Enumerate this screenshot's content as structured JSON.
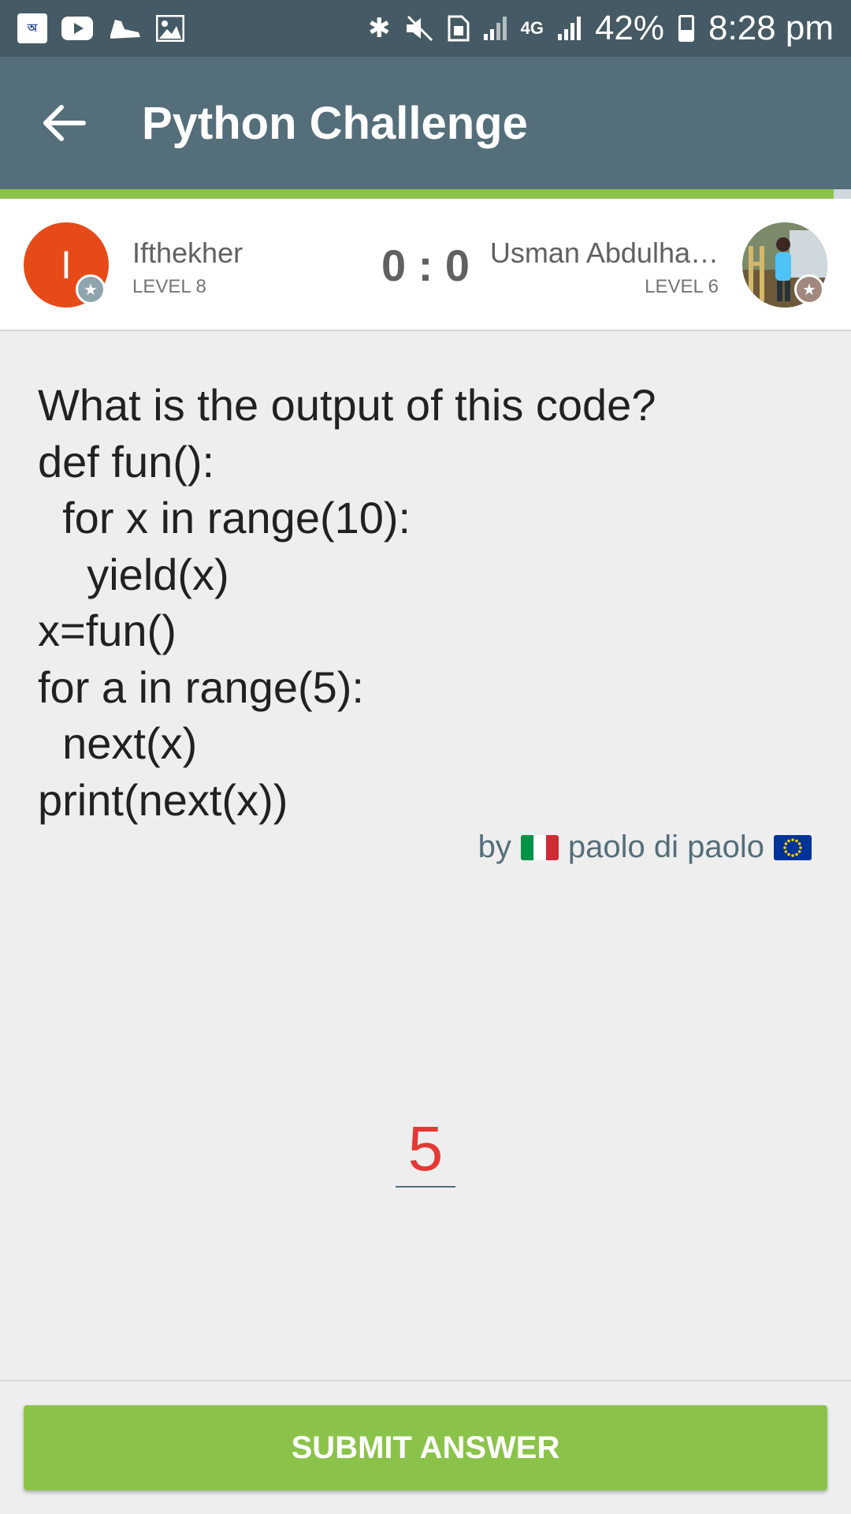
{
  "status_bar": {
    "battery": "42%",
    "time": "8:28 pm",
    "network": "4G",
    "icons_left": [
      "bangla-app-icon",
      "youtube-icon",
      "shoe-icon",
      "gallery-icon"
    ],
    "icons_right": [
      "bluetooth-icon",
      "mute-icon",
      "sim-icon",
      "signal-icon",
      "4g-icon",
      "signal-icon",
      "battery-icon"
    ]
  },
  "toolbar": {
    "title": "Python Challenge",
    "back_icon": "arrow-back-icon"
  },
  "progress": {
    "fraction": 0.98,
    "color": "#8bc34a"
  },
  "player_left": {
    "initial": "I",
    "name": "Ifthekher",
    "level": "LEVEL 8",
    "avatar_color": "#e64a19"
  },
  "player_right": {
    "name": "Usman Abdulha…",
    "level": "LEVEL 6"
  },
  "score": "0 : 0",
  "question": {
    "lines": [
      "What is the output of this code?",
      "def fun():",
      "  for x in range(10):",
      "    yield(x)",
      "x=fun()",
      "for a in range(5):",
      "  next(x)",
      "print(next(x))"
    ]
  },
  "author": {
    "prefix": "by",
    "name": "paolo di paolo"
  },
  "answer": {
    "value": "5"
  },
  "submit": {
    "label": "SUBMIT ANSWER"
  },
  "colors": {
    "status_bar": "#455a64",
    "toolbar": "#546e7a",
    "accent": "#8bc34a",
    "answer_text": "#e53935"
  }
}
